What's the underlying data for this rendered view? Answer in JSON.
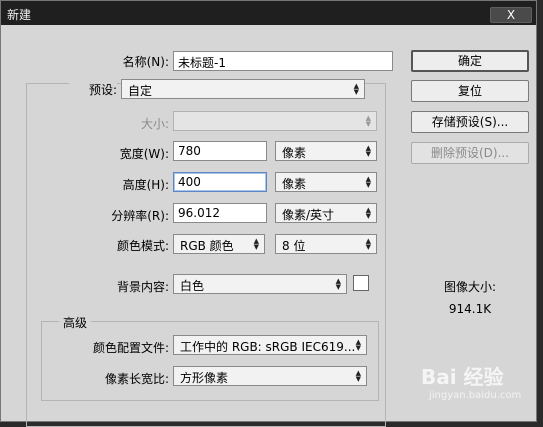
{
  "window": {
    "title": "新建",
    "close_label": "X"
  },
  "name": {
    "label": "名称(N):",
    "value": "未标题-1"
  },
  "preset": {
    "label": "预设:",
    "value": "自定"
  },
  "size": {
    "label": "大小:",
    "value": ""
  },
  "width": {
    "label": "宽度(W):",
    "value": "780",
    "unit": "像素"
  },
  "height": {
    "label": "高度(H):",
    "value": "400",
    "unit": "像素"
  },
  "resolution": {
    "label": "分辨率(R):",
    "value": "96.012",
    "unit": "像素/英寸"
  },
  "color_mode": {
    "label": "颜色模式:",
    "value": "RGB 颜色",
    "depth": "8 位"
  },
  "background": {
    "label": "背景内容:",
    "value": "白色",
    "swatch_color": "#ffffff"
  },
  "advanced": {
    "title": "高级",
    "profile_label": "颜色配置文件:",
    "profile_value": "工作中的 RGB: sRGB IEC619...",
    "aspect_label": "像素长宽比:",
    "aspect_value": "方形像素"
  },
  "buttons": {
    "ok": "确定",
    "reset": "复位",
    "save_preset": "存储预设(S)...",
    "delete_preset": "删除预设(D)..."
  },
  "image_size": {
    "label": "图像大小:",
    "value": "914.1K"
  },
  "watermark": {
    "main": "Bai 经验",
    "sub": "jingyan.baidu.com"
  }
}
